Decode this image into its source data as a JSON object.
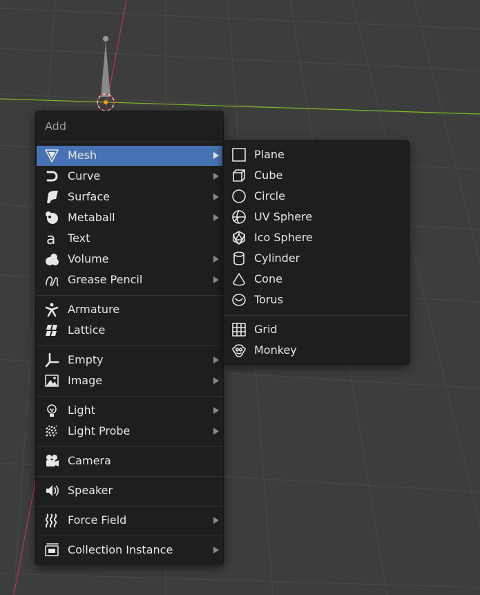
{
  "add_menu": {
    "title": "Add",
    "groups": [
      [
        {
          "label": "Mesh",
          "icon": "mesh-icon",
          "submenu": true,
          "active": true
        },
        {
          "label": "Curve",
          "icon": "curve-icon",
          "submenu": true
        },
        {
          "label": "Surface",
          "icon": "surface-icon",
          "submenu": true
        },
        {
          "label": "Metaball",
          "icon": "metaball-icon",
          "submenu": true
        },
        {
          "label": "Text",
          "icon": "text-icon",
          "submenu": false
        },
        {
          "label": "Volume",
          "icon": "volume-icon",
          "submenu": true
        },
        {
          "label": "Grease Pencil",
          "icon": "grease-pencil-icon",
          "submenu": true
        }
      ],
      [
        {
          "label": "Armature",
          "icon": "armature-icon",
          "submenu": false
        },
        {
          "label": "Lattice",
          "icon": "lattice-icon",
          "submenu": false
        }
      ],
      [
        {
          "label": "Empty",
          "icon": "empty-icon",
          "submenu": true
        },
        {
          "label": "Image",
          "icon": "image-icon",
          "submenu": true
        }
      ],
      [
        {
          "label": "Light",
          "icon": "light-icon",
          "submenu": true
        },
        {
          "label": "Light Probe",
          "icon": "light-probe-icon",
          "submenu": true
        }
      ],
      [
        {
          "label": "Camera",
          "icon": "camera-icon",
          "submenu": false
        }
      ],
      [
        {
          "label": "Speaker",
          "icon": "speaker-icon",
          "submenu": false
        }
      ],
      [
        {
          "label": "Force Field",
          "icon": "force-field-icon",
          "submenu": true
        }
      ],
      [
        {
          "label": "Collection Instance",
          "icon": "collection-instance-icon",
          "submenu": true
        }
      ]
    ]
  },
  "mesh_submenu": {
    "groups": [
      [
        {
          "label": "Plane",
          "icon": "plane-icon"
        },
        {
          "label": "Cube",
          "icon": "cube-icon"
        },
        {
          "label": "Circle",
          "icon": "circle-icon"
        },
        {
          "label": "UV Sphere",
          "icon": "uv-sphere-icon"
        },
        {
          "label": "Ico Sphere",
          "icon": "ico-sphere-icon"
        },
        {
          "label": "Cylinder",
          "icon": "cylinder-icon"
        },
        {
          "label": "Cone",
          "icon": "cone-icon"
        },
        {
          "label": "Torus",
          "icon": "torus-icon"
        }
      ],
      [
        {
          "label": "Grid",
          "icon": "grid-icon"
        },
        {
          "label": "Monkey",
          "icon": "monkey-icon"
        }
      ]
    ]
  },
  "colors": {
    "viewport_bg": "#3d3d3d",
    "grid_line": "#4a4a4a",
    "x_axis": "#b83a46",
    "y_axis": "#86b827",
    "menu_bg": "#1e1e1e",
    "highlight": "#4772b3",
    "text": "#e6e6e6",
    "title_text": "#9a9a9a"
  }
}
